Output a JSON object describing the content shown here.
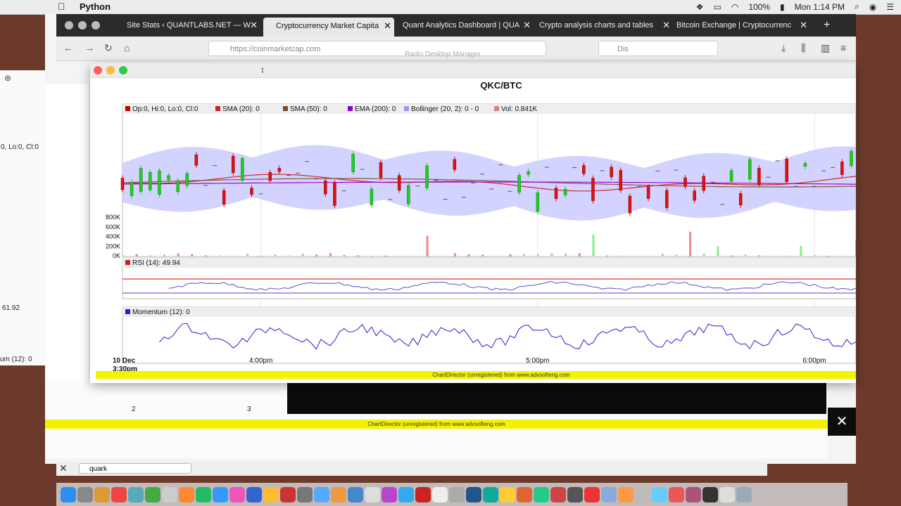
{
  "menubar": {
    "app_name": "Python",
    "battery": "100%",
    "clock": "Mon 1:14 PM"
  },
  "browser": {
    "tabs": [
      {
        "label": "Site Stats ‹ QUANTLABS.NET — W"
      },
      {
        "label": "Cryptocurrency Market Capita",
        "active": true
      },
      {
        "label": "Quant Analytics Dashboard | QUA"
      },
      {
        "label": "Crypto analysis charts and tables"
      },
      {
        "label": "Bitcoin Exchange | Cryptocurrenc"
      }
    ],
    "url": "https://coinmarketcap.com",
    "search": "Dis",
    "overlay_title": "Radio Desktop Manager"
  },
  "background_app": {
    "legend_fragment": "0, Lo:0, Cl:0",
    "rsi_fragment": "61.92",
    "momentum_fragment": "um (12): 0",
    "x_ticks": [
      "2",
      "3"
    ],
    "footer": "ChartDirector (unregistered) from www.advsofteng.com",
    "search_value": "quark"
  },
  "chart_data": {
    "type": "candlestick",
    "title": "QKC/BTC",
    "legend": [
      {
        "label": "Op:0, Hi:0, Lo:0, Cl:0",
        "color": "#c00000"
      },
      {
        "label": "SMA (20): 0",
        "color": "#cc2222"
      },
      {
        "label": "SMA (50): 0",
        "color": "#7a4a2a"
      },
      {
        "label": "EMA (200): 0",
        "color": "#8800cc"
      },
      {
        "label": "Bollinger (20, 2): 0 - 0",
        "color": "#9999ee"
      },
      {
        "label": "Vol: 0.841K",
        "color": "#cc8888"
      }
    ],
    "volume_ticks": [
      "800K",
      "600K",
      "400K",
      "200K",
      "0K"
    ],
    "volume_range": [
      0,
      1000000
    ],
    "rsi_label": "RSI (14): 49.94",
    "momentum_label": "Momentum (12): 0",
    "x_labels": [
      {
        "t": 0,
        "label": "10 Dec",
        "sub": "3:30pm"
      },
      {
        "t": 30,
        "label": "4:00pm"
      },
      {
        "t": 90,
        "label": "5:00pm"
      },
      {
        "t": 150,
        "label": "6:00pm"
      }
    ],
    "x_range_minutes": [
      0,
      159
    ],
    "footer": "ChartDirector (unregistered) from www.advsofteng.com",
    "colors": {
      "up": "#22cc22",
      "down": "#dd1111",
      "band": "#c8c8ff",
      "sma20": "#dd2233",
      "sma50": "#7a5a3a",
      "ema200": "#aa00dd",
      "rsi": "#5555cc",
      "momentum": "#2222cc"
    }
  }
}
